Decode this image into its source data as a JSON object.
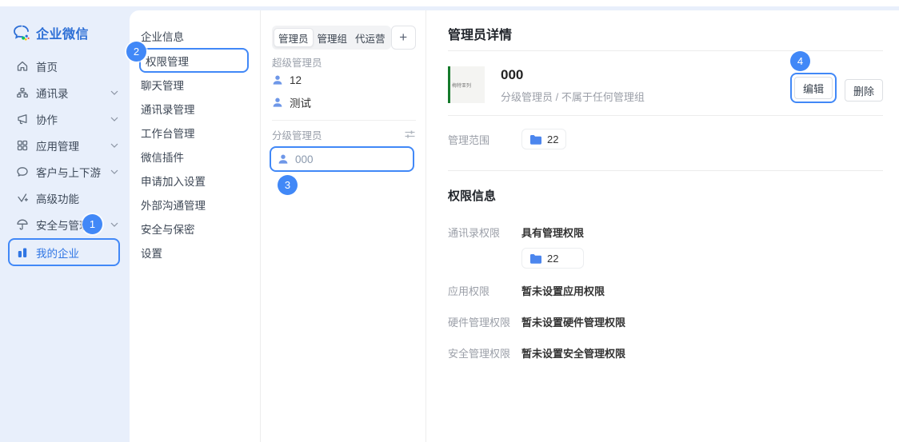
{
  "colors": {
    "accent_annotation": "#4188F7",
    "sidebar_background": "#E8EFFB",
    "brand_blue": "#2D6FD6",
    "selected_item_blue": "#3076E4",
    "person_icon_blue": "#6E97E8",
    "folder_icon_blue": "#4C86EE",
    "avatar_green_bar": "#157A2B",
    "label_gray": "#9B9FA8",
    "text_dark": "#333333"
  },
  "sidebar": {
    "logo_text": "企业微信",
    "items": [
      {
        "label": "首页"
      },
      {
        "label": "通讯录"
      },
      {
        "label": "协作"
      },
      {
        "label": "应用管理"
      },
      {
        "label": "客户与上下游"
      },
      {
        "label": "高级功能"
      },
      {
        "label": "安全与管理"
      },
      {
        "label": "我的企业"
      }
    ]
  },
  "settings_menu": {
    "items": [
      {
        "label": "企业信息"
      },
      {
        "label": "权限管理"
      },
      {
        "label": "聊天管理"
      },
      {
        "label": "通讯录管理"
      },
      {
        "label": "工作台管理"
      },
      {
        "label": "微信插件"
      },
      {
        "label": "申请加入设置"
      },
      {
        "label": "外部沟通管理"
      },
      {
        "label": "安全与保密"
      },
      {
        "label": "设置"
      }
    ]
  },
  "admin_panel": {
    "tabs": [
      {
        "label": "管理员"
      },
      {
        "label": "管理组"
      },
      {
        "label": "代运营"
      }
    ],
    "add_button": "+",
    "super_admin_group": {
      "title": "超级管理员",
      "members": [
        {
          "name": "12"
        },
        {
          "name": "测试"
        }
      ]
    },
    "scoped_admin_group": {
      "title": "分级管理员",
      "members": [
        {
          "name": "000"
        }
      ]
    }
  },
  "detail": {
    "title": "管理员详情",
    "profile": {
      "name": "000",
      "description": "分级管理员 / 不属于任何管理组",
      "avatar_text": "梅特亚列",
      "edit_button": "编辑",
      "delete_button": "删除"
    },
    "scope": {
      "label": "管理范围",
      "folder_count": "22"
    },
    "permissions": {
      "title": "权限信息",
      "contacts": {
        "label": "通讯录权限",
        "value": "具有管理权限",
        "folder_count": "22"
      },
      "apps": {
        "label": "应用权限",
        "value": "暂未设置应用权限"
      },
      "hardware": {
        "label": "硬件管理权限",
        "value": "暂未设置硬件管理权限"
      },
      "security": {
        "label": "安全管理权限",
        "value": "暂未设置安全管理权限"
      }
    }
  },
  "annotations": {
    "step1": "1",
    "step2": "2",
    "step3": "3",
    "step4": "4"
  }
}
